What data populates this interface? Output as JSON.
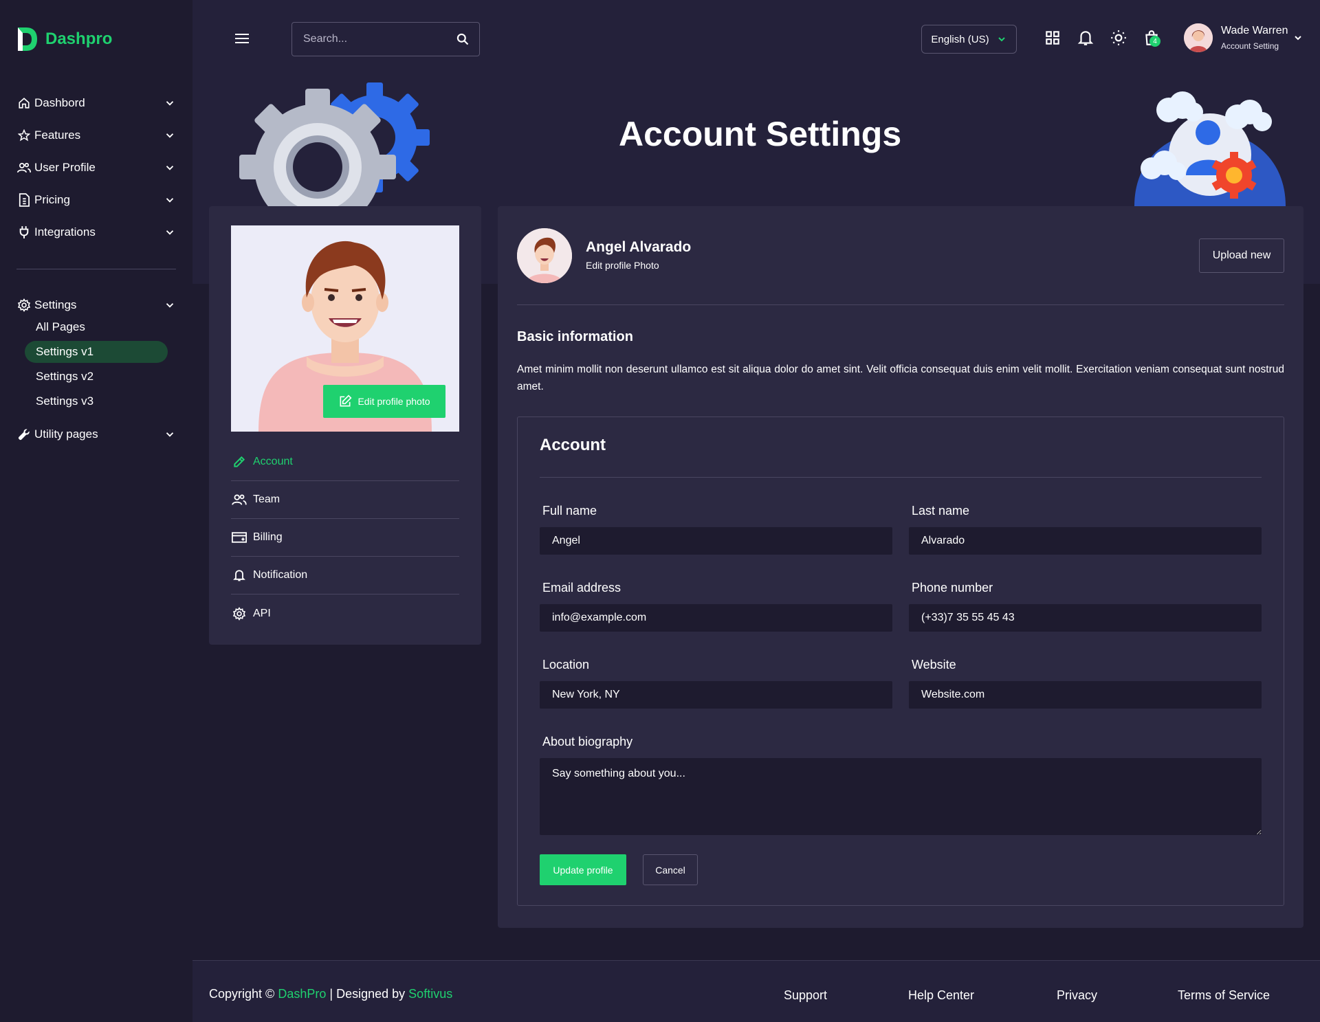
{
  "brand": {
    "name": "Dashpro"
  },
  "sidebar": {
    "items": [
      {
        "label": "Dashbord",
        "icon": "home-icon"
      },
      {
        "label": "Features",
        "icon": "star-icon"
      },
      {
        "label": "User Profile",
        "icon": "users-icon"
      },
      {
        "label": "Pricing",
        "icon": "invoice-icon"
      },
      {
        "label": "Integrations",
        "icon": "plug-icon"
      }
    ],
    "settings": {
      "label": "Settings",
      "icon": "gear-icon",
      "subitems": [
        "All Pages",
        "Settings v1",
        "Settings v2",
        "Settings v3"
      ],
      "active": "Settings v1"
    },
    "utility": {
      "label": "Utility pages",
      "icon": "wrench-icon"
    }
  },
  "topbar": {
    "search_placeholder": "Search...",
    "language": "English (US)",
    "cart_count": "4",
    "user_name": "Wade Warren",
    "user_sub": "Account Setting"
  },
  "page": {
    "title": "Account Settings"
  },
  "profile_card": {
    "edit_photo_label": "Edit profile photo",
    "menu": [
      "Account",
      "Team",
      "Billing",
      "Notification",
      "API"
    ],
    "active": "Account"
  },
  "main": {
    "name": "Angel Alvarado",
    "edit_photo": "Edit profile Photo",
    "upload_label": "Upload new",
    "basic_title": "Basic information",
    "basic_text": "Amet minim mollit non deserunt ullamco est sit aliqua dolor do amet sint. Velit officia consequat duis enim velit mollit. Exercitation veniam consequat sunt nostrud amet.",
    "account_title": "Account",
    "fields": {
      "full_name": {
        "label": "Full name",
        "value": "Angel"
      },
      "last_name": {
        "label": "Last name",
        "value": "Alvarado"
      },
      "email": {
        "label": "Email address",
        "value": "info@example.com"
      },
      "phone": {
        "label": "Phone number",
        "value": "(+33)7 35 55 45 43"
      },
      "location": {
        "label": "Location",
        "value": "New York, NY"
      },
      "website": {
        "label": "Website",
        "value": "Website.com"
      },
      "bio": {
        "label": "About biography",
        "placeholder": "Say something about you..."
      }
    },
    "update_label": "Update profile",
    "cancel_label": "Cancel"
  },
  "footer": {
    "copyright_prefix": "Copyright ©",
    "brand": "DashPro",
    "separator": "|",
    "designed_by": "Designed by",
    "designer": "Softivus",
    "links": [
      "Support",
      "Help Center",
      "Privacy",
      "Terms of Service"
    ]
  },
  "colors": {
    "accent": "#1fd16f",
    "background": "#24213a",
    "panel": "#2c2942",
    "sidebar": "#1e1b2f"
  }
}
